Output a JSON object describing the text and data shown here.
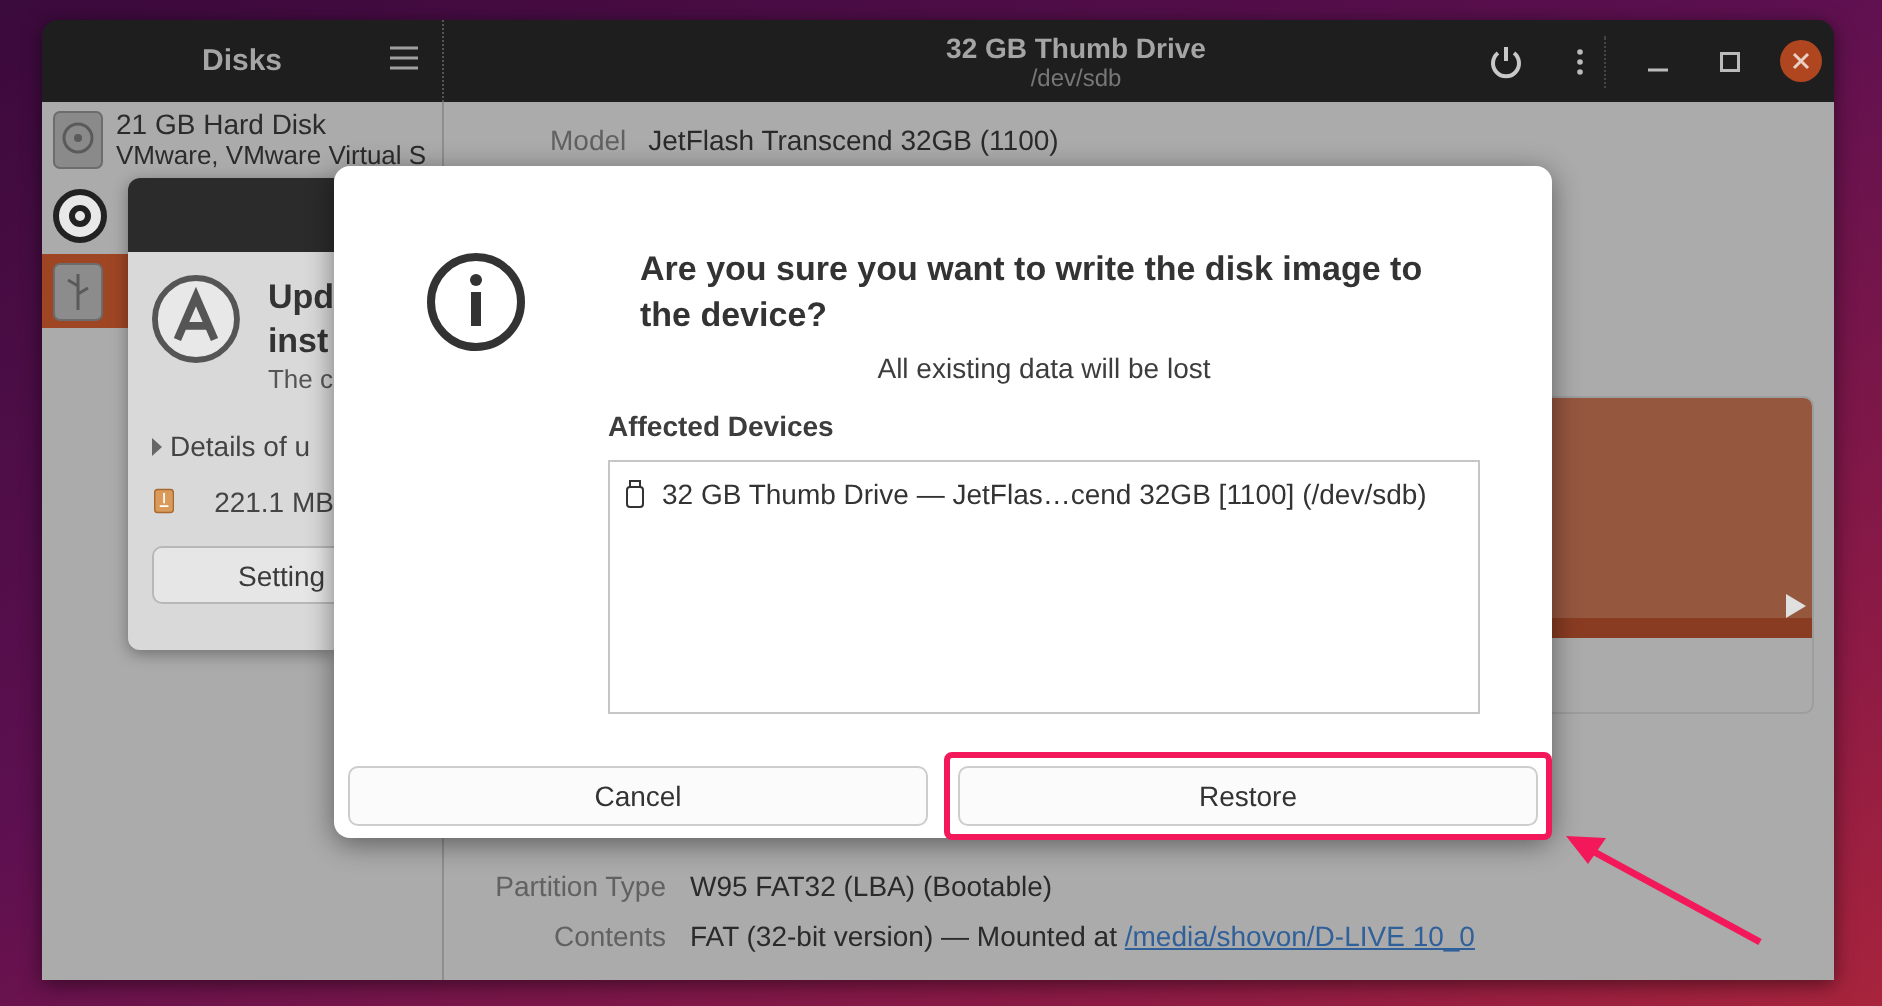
{
  "disks_window": {
    "sidebar_title": "Disks",
    "title": "32 GB Thumb Drive",
    "subtitle": "/dev/sdb",
    "drives": [
      {
        "name": "21 GB Hard Disk",
        "detail": "VMware, VMware Virtual S",
        "kind": "harddisk",
        "selected": false
      },
      {
        "kind": "optical",
        "selected": false
      },
      {
        "kind": "usb",
        "selected": true
      }
    ],
    "model": {
      "label": "Model",
      "value": "JetFlash Transcend 32GB (1100)"
    },
    "properties": [
      {
        "label": "Partition Type",
        "value": "W95 FAT32 (LBA) (Bootable)"
      },
      {
        "label": "Contents",
        "value": "FAT (32-bit version) — Mounted at",
        "link": "/media/shovon/D-LIVE 10_0"
      }
    ]
  },
  "updater_window": {
    "title": "Upd",
    "subtitle": "inst",
    "message": "The c",
    "details": "Details of u",
    "download_size": "221.1 MB",
    "settings_button": "Setting"
  },
  "dialog": {
    "title": "Are you sure you want to write the disk image to the device?",
    "message": "All existing data will be lost",
    "section": "Affected Devices",
    "devices": [
      "32 GB Thumb Drive — JetFlas…cend 32GB [1100] (/dev/sdb)"
    ],
    "buttons": [
      {
        "label": "Cancel",
        "highlighted": false
      },
      {
        "label": "Restore",
        "highlighted": true
      }
    ]
  }
}
